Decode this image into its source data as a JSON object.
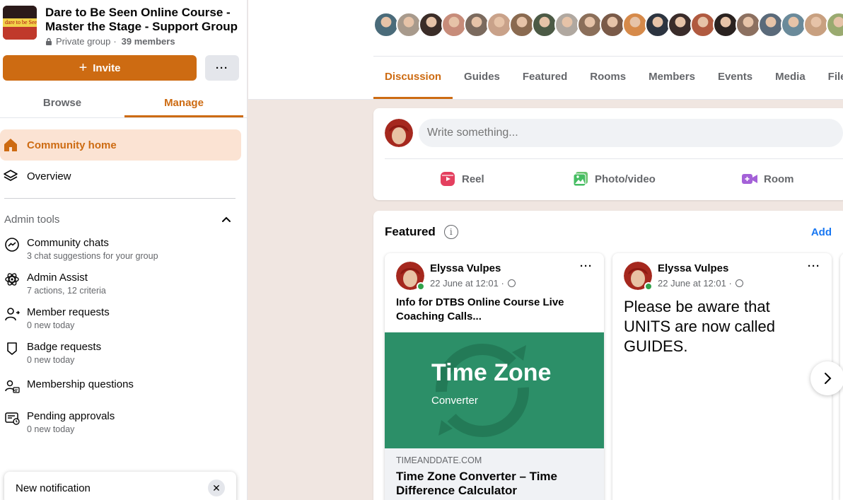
{
  "group": {
    "title": "Dare to Be Seen Online Course - Master the Stage - Support Group",
    "privacy": "Private group",
    "separator": "·",
    "members": "39 members",
    "thumb_text": "Dare to be Seen"
  },
  "actions": {
    "invite_label": "Invite",
    "more_label": "···"
  },
  "side_tabs": [
    {
      "label": "Browse",
      "active": false
    },
    {
      "label": "Manage",
      "active": true
    }
  ],
  "nav": {
    "community_home": "Community home",
    "overview": "Overview"
  },
  "admin": {
    "heading": "Admin tools",
    "items": [
      {
        "title": "Community chats",
        "sub": "3 chat suggestions for your group",
        "icon": "messenger-icon"
      },
      {
        "title": "Admin Assist",
        "sub": "7 actions, 12 criteria",
        "icon": "atom-icon"
      },
      {
        "title": "Member requests",
        "sub": "0 new today",
        "icon": "person-add-icon"
      },
      {
        "title": "Badge requests",
        "sub": "0 new today",
        "icon": "badge-icon"
      },
      {
        "title": "Membership questions",
        "sub": "",
        "icon": "people-questions-icon"
      },
      {
        "title": "Pending approvals",
        "sub": "0 new today",
        "icon": "pending-icon"
      }
    ]
  },
  "notification": {
    "label": "New notification",
    "close": "✕"
  },
  "avatar_colors": [
    "#4a6b7a",
    "#a89a8c",
    "#3b2d28",
    "#c78c7a",
    "#7b6a5e",
    "#c9a28a",
    "#8a6a50",
    "#4c5a45",
    "#b0a8a0",
    "#8b6f5a",
    "#7a5a48",
    "#d68a4a",
    "#2c3440",
    "#3a2c2a",
    "#b05a40",
    "#2a2220",
    "#8c7060",
    "#5a6a7a",
    "#6a8a9a",
    "#c8a080",
    "#9aaa70"
  ],
  "main_tabs": [
    "Discussion",
    "Guides",
    "Featured",
    "Rooms",
    "Members",
    "Events",
    "Media",
    "Files"
  ],
  "composer": {
    "placeholder": "Write something...",
    "reel": "Reel",
    "photo": "Photo/video",
    "room": "Room"
  },
  "featured": {
    "heading": "Featured",
    "info": "i",
    "add": "Add",
    "cards": [
      {
        "author": "Elyssa Vulpes",
        "time": "22 June at 12:01 ·",
        "text": "Info for DTBS Online Course Live Coaching Calls...",
        "image_title": "Time Zone",
        "image_sub": "Converter",
        "link_domain": "TIMEANDDATE.COM",
        "link_title": "Time Zone Converter – Time Difference Calculator"
      },
      {
        "author": "Elyssa Vulpes",
        "time": "22 June at 12:01 ·",
        "text": "Please be aware that UNITS are now called GUIDES."
      }
    ]
  },
  "colors": {
    "accent": "#cd6b12",
    "accent_light": "#fbe3d3",
    "link": "#1877f2",
    "tz_green": "#2c8f68"
  }
}
